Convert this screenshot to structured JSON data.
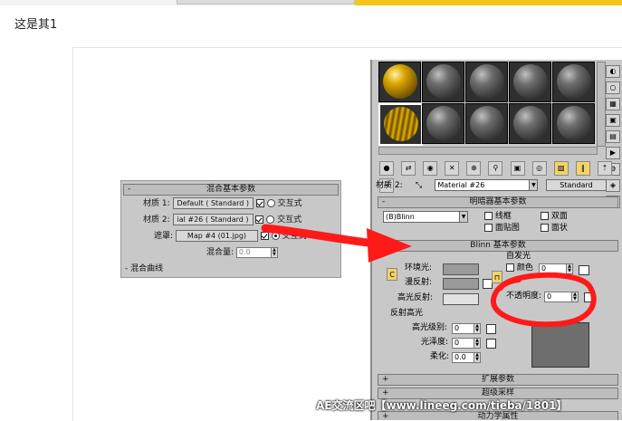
{
  "caption": "这是其1",
  "blend_panel": {
    "title": "混合基本参数",
    "material1_label": "材质 1:",
    "material1_value": "Default  ( Standard )",
    "material2_label": "材质 2:",
    "material2_value": "ial #26  ( Standard )",
    "mask_label": "遮罩:",
    "mask_value": "Map #4 (01.jpg)",
    "interactive": "交互式",
    "mix_amount_label": "混合量:",
    "mix_amount_value": "0.0",
    "curve_label": "混合曲线"
  },
  "material_editor": {
    "material_label": "材质 2:",
    "material_name": "Material #26",
    "material_type": "Standard",
    "shader_rollout": "明暗器基本参数",
    "shader_value": "(B)Blinn",
    "shader_options": [
      "线框",
      "双面",
      "面贴图",
      "面状"
    ],
    "blinn_rollout": "Blinn 基本参数",
    "self_illum": "自发光",
    "color_label": "颜色",
    "color_value": "0",
    "ambient": "环境光:",
    "diffuse": "漫反射:",
    "specular": "高光反射:",
    "opacity_label": "不透明度:",
    "opacity_value": "0",
    "spec_highlights": "反射高光",
    "spec_level_label": "高光级别:",
    "spec_level_value": "0",
    "glossiness_label": "光泽度:",
    "glossiness_value": "0",
    "soften_label": "柔化:",
    "soften_value": "0.0",
    "extended_rollout": "扩展参数",
    "supersampling_rollout": "超级采样",
    "dynamics_rollout": "动力学属性"
  },
  "watermark": "AE交流区吧【www.lineeg.com/tieba/1801】",
  "colors": {
    "annotation": "#ff1a1a",
    "panel": "#c8c8c8",
    "highlight": "#f5c518"
  }
}
